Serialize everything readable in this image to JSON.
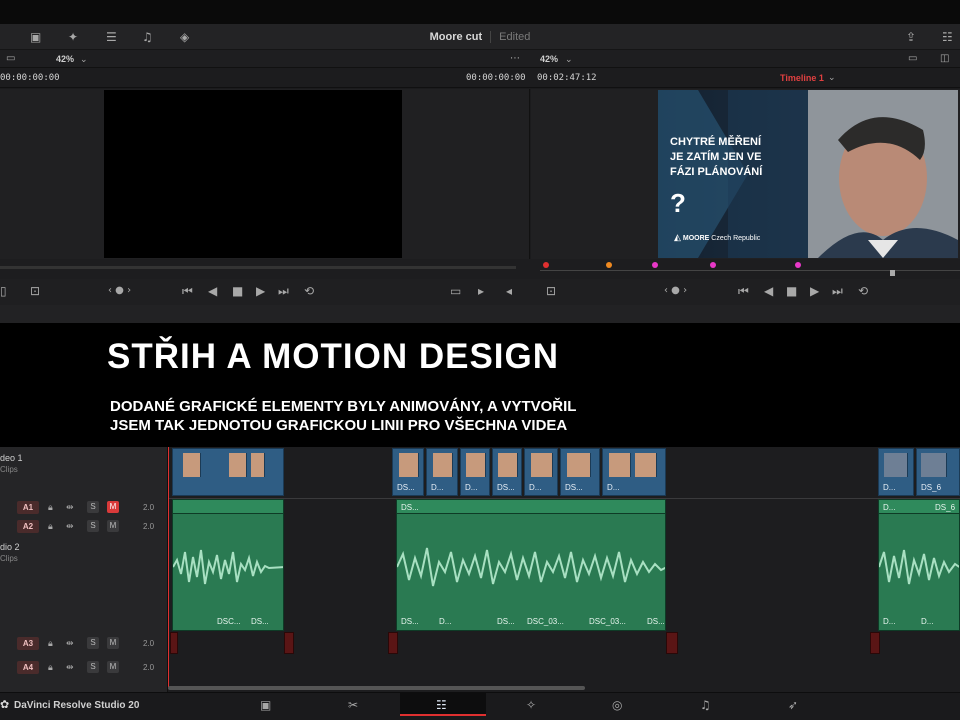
{
  "window": {
    "project_title": "Moore cut",
    "status": "Edited"
  },
  "source_viewer": {
    "zoom": "42%",
    "timecode_left": "00:00:00:00",
    "timecode_right": "00:00:00:00"
  },
  "program_viewer": {
    "zoom": "42%",
    "timecode": "00:02:47:12",
    "timeline_name": "Timeline 1",
    "frame": {
      "headline_lines": [
        "CHYTRÉ MĚŘENÍ",
        "JE ZATÍM JEN VE",
        "FÁZI PLÁNOVÁNÍ"
      ],
      "question_mark": "?",
      "logo_text": "MOORE",
      "logo_sub": "Czech Republic"
    }
  },
  "banner": {
    "title": "STŘIH A MOTION DESIGN",
    "subtitle_lines": [
      "DODANÉ GRAFICKÉ ELEMENTY BYLY ANIMOVÁNY, A VYTVOŘIL",
      "JSEM TAK JEDNOTOU GRAFICKOU LINII PRO VŠECHNA VIDEA"
    ]
  },
  "tracks": {
    "video1": {
      "name": "deo 1",
      "sub": "Clips"
    },
    "a1": {
      "label": "A1",
      "vol": "2.0"
    },
    "a2": {
      "label": "A2",
      "vol": "2.0",
      "name": "dio 2",
      "sub": "Clips"
    },
    "a3": {
      "label": "A3",
      "vol": "2.0"
    },
    "a4": {
      "label": "A4",
      "vol": "2.0"
    }
  },
  "clips": {
    "video_labels": [
      "DS...",
      "D...",
      "D...",
      "DS...",
      "D...",
      "DS...",
      "D...",
      "D...",
      "DS_6"
    ],
    "audio_top_labels": [
      "DS...",
      "DS...",
      "D...",
      "DS_6"
    ],
    "audio_bottom_labels": [
      "DSC...",
      "DS...",
      "DS...",
      "D...",
      "DS...",
      "DSC_03...",
      "DSC_03...",
      "DS...",
      "D...",
      "D..."
    ]
  },
  "footer": {
    "app_name": "DaVinci Resolve Studio 20"
  },
  "colors": {
    "accent_red": "#e03030",
    "video_clip": "#2f5d84",
    "audio_clip": "#2a7a52"
  }
}
